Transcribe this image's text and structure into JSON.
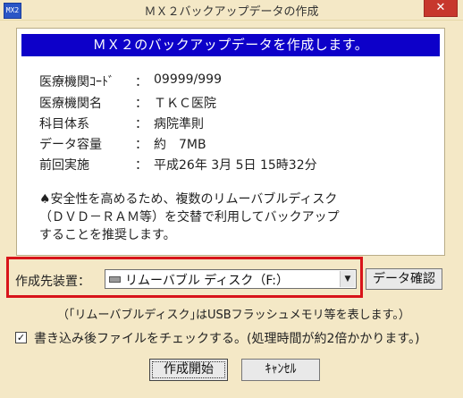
{
  "window": {
    "title": "ＭＸ２バックアップデータの作成",
    "app_icon_text": "MX2",
    "close_label": "✕"
  },
  "banner": {
    "text": "ＭＸ２のバックアップデータを作成します。"
  },
  "info": [
    {
      "label": "医療機関ｺｰﾄﾞ",
      "colon": "：",
      "value": "09999/999"
    },
    {
      "label": "医療機関名",
      "colon": "：",
      "value": "ＴＫＣ医院"
    },
    {
      "label": "科目体系",
      "colon": "：",
      "value": "病院準則"
    },
    {
      "label": "データ容量",
      "colon": "：",
      "value": "約　7MB"
    },
    {
      "label": "前回実施",
      "colon": "：",
      "value": "平成26年 3月 5日 15時32分"
    }
  ],
  "notice": {
    "line1": "♠安全性を高めるため、複数のリムーバブルディスク",
    "line2": "（ＤＶＤ－ＲＡＭ等）を交替で利用してバックアップ",
    "line3": "することを推奨します。"
  },
  "destination": {
    "label": "作成先装置：",
    "selected": "リムーバブル ディスク（F:）",
    "arrow": "▼",
    "confirm_button": "データ確認",
    "hint": "（｢リムーバブルディスク｣はUSBフラッシュメモリ等を表します。）"
  },
  "check": {
    "checked": "✓",
    "label": "書き込み後ファイルをチェックする。(処理時間が約2倍かかります。)"
  },
  "buttons": {
    "start": "作成開始",
    "cancel": "ｷｬﾝｾﾙ"
  }
}
